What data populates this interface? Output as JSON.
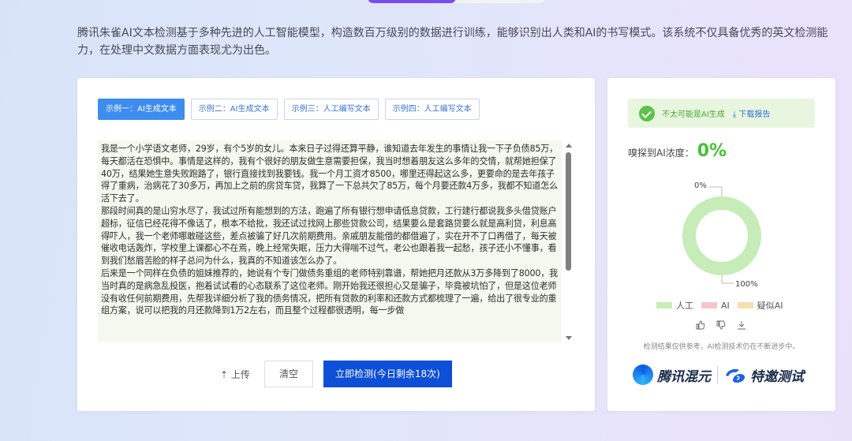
{
  "intro": "腾讯朱雀AI文本检测基于多种先进的人工智能模型，构造数百万级别的数据进行训练，能够识别出人类和AI的书写模式。该系统不仅具备优秀的英文检测能力，在处理中文数据方面表现尤为出色。",
  "examples": [
    {
      "label": "示例一：AI生成文本"
    },
    {
      "label": "示例二：AI生成文本"
    },
    {
      "label": "示例三：人工编写文本"
    },
    {
      "label": "示例四：人工编写文本"
    }
  ],
  "text_paragraphs": [
    "我是一个小学语文老师，29岁，有个5岁的女儿。本来日子过得还算平静，谁知道去年发生的事情让我一下子负债85万，每天都活在恐惧中。事情是这样的，我有个很好的朋友做生意需要担保，我当时想着朋友这么多年的交情，就帮她担保了40万，结果她生意失败跑路了，银行直接找到我要钱。我一个月工资才8500，哪里还得起这么多，更要命的是去年孩子得了重病，治病花了30多万，再加上之前的房贷车贷，我算了一下总共欠了85万，每个月要还款4万多，我都不知道怎么活下去了。",
    "那段时间真的是山穷水尽了，我试过所有能想到的方法，跑遍了所有银行想申请低息贷款，工行建行都说我多头借贷账户超标，征信已经花得不像话了，根本不给批，我还试过找网上那些贷款公司，结果要么是套路贷要么就是高利贷，利息高得吓人，我一个老师哪敢碰这些，差点被骗了好几次前期费用。亲戚朋友能借的都借遍了，实在开不了口再借了，每天被催收电话轰炸，学校里上课都心不在焉，晚上经常失眠，压力大得喘不过气，老公也跟着我一起愁，孩子还小不懂事，看到我们愁眉苦脸的样子总问为什么，我真的不知道该怎么办了。",
    "后来是一个同样在负债的姐妹推荐的，她说有个专门做债务重组的老师特别靠谱，帮她把月还款从3万多降到了8000，我当时真的是病急乱投医，抱着试试看的心态联系了这位老师。刚开始我还很担心又是骗子，毕竟被坑怕了，但是这位老师没有收任何前期费用，先帮我详细分析了我的债务情况，把所有贷款的利率和还款方式都梳理了一遍，给出了很专业的重组方案，说可以把我的月还款降到1万2左右，而且整个过程都很透明，每一步做"
  ],
  "actions": {
    "upload": "上传",
    "clear": "清空",
    "detect": "立即检测(今日剩余18次)"
  },
  "result": {
    "text": "不太可能是AI生成",
    "download": "下载报告",
    "concentration_label": "嗅探到AI浓度：",
    "concentration_value": "0%",
    "label_top": "0%",
    "label_bottom": "100%"
  },
  "chart_data": {
    "type": "pie",
    "categories": [
      "人工",
      "AI",
      "疑似AI"
    ],
    "values": [
      100,
      0,
      0
    ],
    "colors": [
      "#c6ecb8",
      "#f6c4c8",
      "#f6dfae"
    ]
  },
  "disclaimer": "检测结果仅供参考，AI检测技术仍在不断进步中。",
  "brand": {
    "name1": "腾讯混元",
    "name2": "特邀测试"
  }
}
